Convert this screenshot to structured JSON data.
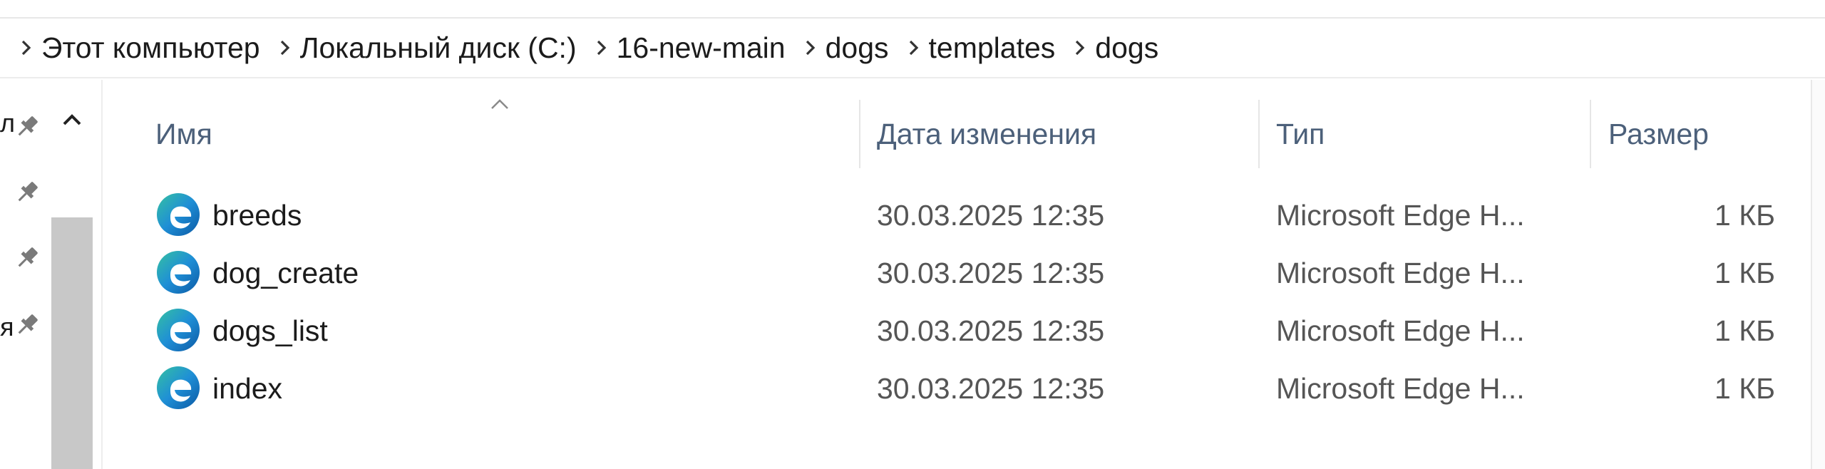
{
  "breadcrumb": {
    "items": [
      "Этот компьютер",
      "Локальный диск (C:)",
      "16-new-main",
      "dogs",
      "templates",
      "dogs"
    ]
  },
  "nav_pane": {
    "cut_labels": [
      "л",
      "я"
    ]
  },
  "columns": {
    "name": "Имя",
    "date": "Дата изменения",
    "type": "Тип",
    "size": "Размер"
  },
  "files": [
    {
      "name": "breeds",
      "date": "30.03.2025 12:35",
      "type": "Microsoft Edge H...",
      "size": "1 КБ",
      "icon": "edge-html-file-icon"
    },
    {
      "name": "dog_create",
      "date": "30.03.2025 12:35",
      "type": "Microsoft Edge H...",
      "size": "1 КБ",
      "icon": "edge-html-file-icon"
    },
    {
      "name": "dogs_list",
      "date": "30.03.2025 12:35",
      "type": "Microsoft Edge H...",
      "size": "1 КБ",
      "icon": "edge-html-file-icon"
    },
    {
      "name": "index",
      "date": "30.03.2025 12:35",
      "type": "Microsoft Edge H...",
      "size": "1 КБ",
      "icon": "edge-html-file-icon"
    }
  ],
  "colors": {
    "header_text": "#4c607a",
    "scroll_thumb": "#c8c8c8",
    "edge_blue": "#0c59a4",
    "edge_green": "#35c1a1"
  }
}
